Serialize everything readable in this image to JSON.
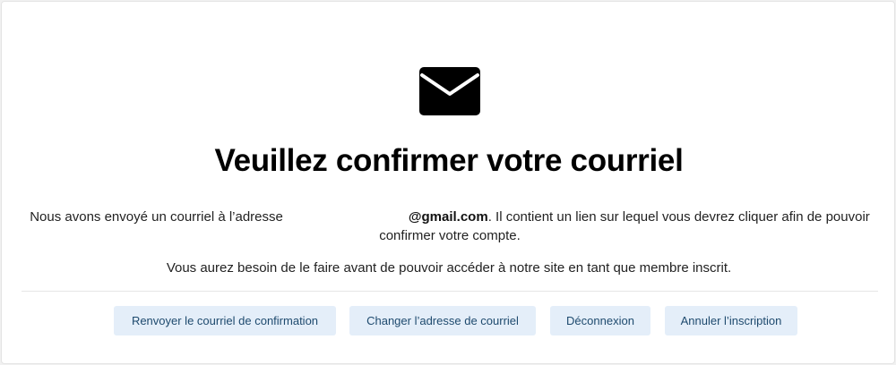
{
  "icon": {
    "name": "envelope-icon",
    "color": "#000000"
  },
  "title": "Veuillez confirmer votre courriel",
  "message": {
    "before_email": "Nous avons envoyé un courriel à l’adresse",
    "email_domain": "@gmail.com",
    "after_email": ". Il contient un lien sur lequel vous devrez cliquer afin de pouvoir confirmer votre compte."
  },
  "note": "Vous aurez besoin de le faire avant de pouvoir accéder à notre site en tant que membre inscrit.",
  "buttons": {
    "resend": "Renvoyer le courriel de confirmation",
    "change_email": "Changer l’adresse de courriel",
    "logout": "Déconnexion",
    "cancel": "Annuler l’inscription"
  },
  "colors": {
    "button_bg": "#e4eef9",
    "button_text": "#1e4a6e"
  }
}
